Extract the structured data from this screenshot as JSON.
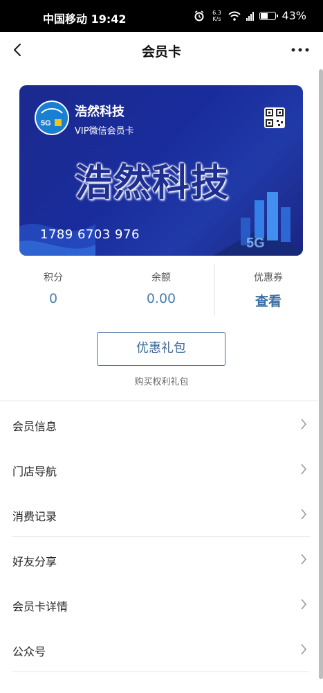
{
  "status_bar": {
    "carrier_time": "中国移动 19:42",
    "net_speed_value": "6.3",
    "net_speed_unit": "K/s",
    "battery": "43%"
  },
  "nav": {
    "title": "会员卡"
  },
  "card": {
    "brand_name": "浩然科技",
    "card_type": "VIP微信会员卡",
    "watermark": "浩然科技",
    "card_number": "1789 6703 976",
    "logo_badge": "5G"
  },
  "stats": [
    {
      "label": "积分",
      "value": "0"
    },
    {
      "label": "余额",
      "value": "0.00"
    },
    {
      "label": "优惠券",
      "value": "查看"
    }
  ],
  "gift": {
    "button_label": "优惠礼包",
    "caption": "购买权利礼包"
  },
  "menu": [
    {
      "label": "会员信息"
    },
    {
      "label": "门店导航"
    },
    {
      "label": "消费记录"
    },
    {
      "label": "好友分享"
    },
    {
      "label": "会员卡详情"
    },
    {
      "label": "公众号"
    }
  ]
}
